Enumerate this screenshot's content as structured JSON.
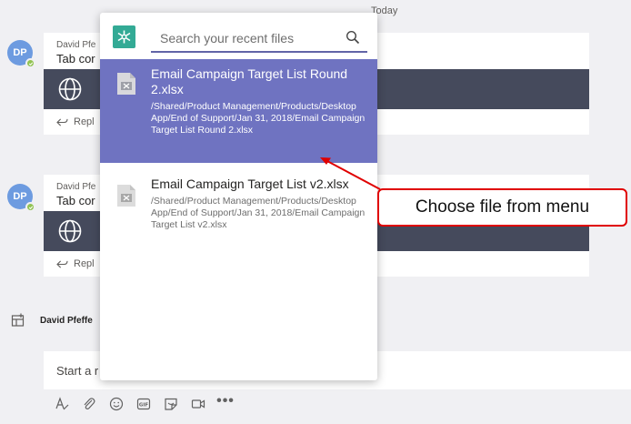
{
  "timeline": {
    "date_label": "Today"
  },
  "messages": [
    {
      "avatar_initials": "DP",
      "sender": "David Pfe",
      "text": "Tab cor",
      "reply_label": "Repl"
    },
    {
      "avatar_initials": "DP",
      "sender": "David Pfe",
      "text": "Tab cor",
      "reply_label": "Repl"
    }
  ],
  "activity": {
    "text": "David Pfeffe"
  },
  "compose": {
    "placeholder": "Start a r"
  },
  "popup": {
    "search_placeholder": "Search your recent files",
    "results": [
      {
        "title": "Email Campaign Target List Round 2.xlsx",
        "path": "/Shared/Product Management/Products/Desktop App/End of Support/Jan 31, 2018/Email Campaign Target List Round 2.xlsx",
        "selected": true
      },
      {
        "title": "Email Campaign Target List v2.xlsx",
        "path": "/Shared/Product Management/Products/Desktop App/End of Support/Jan 31, 2018/Email Campaign Target List v2.xlsx",
        "selected": false
      }
    ]
  },
  "annotation": {
    "callout_text": "Choose file from menu",
    "color": "#e00000"
  },
  "colors": {
    "accent": "#6264a7",
    "selected_row": "#6f73c1",
    "app_icon": "#33aa95",
    "banner": "#454a5c"
  }
}
